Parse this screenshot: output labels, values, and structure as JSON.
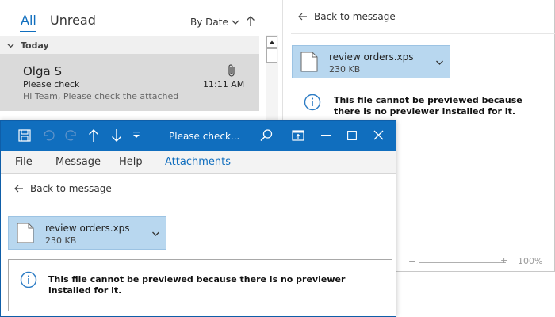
{
  "mail_list": {
    "tabs": [
      {
        "label": "All",
        "active": true
      },
      {
        "label": "Unread",
        "active": false
      }
    ],
    "sort_label": "By Date",
    "group_label": "Today",
    "items": [
      {
        "sender": "Olga S",
        "subject": "Please check",
        "time": "11:11 AM",
        "preview": "Hi Team,  Please check the attached",
        "has_attachment": true
      }
    ]
  },
  "reading_pane": {
    "back_label": "Back to message",
    "attachment": {
      "name": "review orders.xps",
      "size": "230 KB"
    },
    "message": "This file cannot be previewed because there is no previewer installed for it.",
    "zoom": {
      "level": "100%",
      "minus": "−",
      "plus": "+"
    }
  },
  "front_window": {
    "title": "Please check...",
    "ribbon_tabs": [
      {
        "label": "File",
        "active": false
      },
      {
        "label": "Message",
        "active": false
      },
      {
        "label": "Help",
        "active": false
      },
      {
        "label": "Attachments",
        "active": true
      }
    ],
    "back_label": "Back to message",
    "attachment": {
      "name": "review orders.xps",
      "size": "230 KB"
    },
    "message": "This file cannot be previewed because there is no previewer installed for it."
  },
  "icons": {
    "save": "save-icon",
    "undo": "undo-icon",
    "redo": "redo-icon",
    "up": "arrow-up-icon",
    "down": "arrow-down-icon",
    "customize": "customize-toolbar-icon",
    "search": "search-icon",
    "popout": "popout-icon",
    "minimize": "minimize-icon",
    "maximize": "maximize-icon",
    "close": "close-icon",
    "attachment": "paperclip-icon",
    "info": "info-icon",
    "document": "document-icon"
  },
  "colors": {
    "accent": "#106ebe",
    "selected_row": "#dadada",
    "attachment_chip": "#b8d7ef",
    "info_icon": "#2b7bc4"
  }
}
